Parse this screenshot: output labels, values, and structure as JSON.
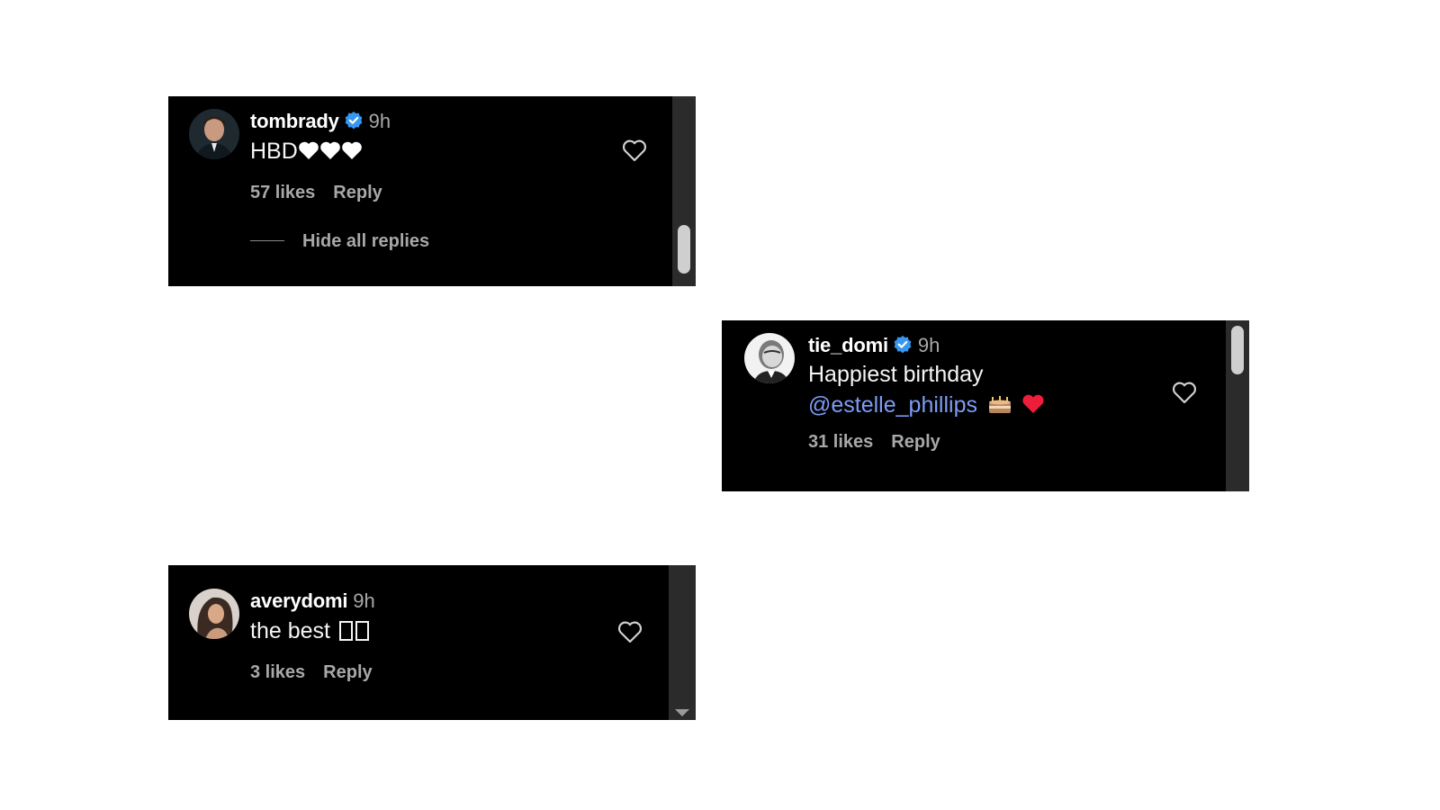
{
  "colors": {
    "background": "#ffffff",
    "card": "#000000",
    "scrollbar_track": "#2b2b2b",
    "verified_badge": "#3897f0",
    "mention": "#7d9cf7",
    "muted_text": "#a8a8a8"
  },
  "comments": [
    {
      "username": "tombrady",
      "verified": true,
      "time": "9h",
      "text": "HBD",
      "emoji": [
        "white-heart",
        "white-heart",
        "white-heart"
      ],
      "likes": "57 likes",
      "reply": "Reply",
      "hide_replies": "Hide all replies",
      "avatar_icon": "profile-photo-tombrady"
    },
    {
      "username": "tie_domi",
      "verified": true,
      "time": "9h",
      "text": "Happiest birthday",
      "mention": "@estelle_phillips",
      "emoji": [
        "birthday-cake",
        "red-heart"
      ],
      "likes": "31 likes",
      "reply": "Reply",
      "avatar_icon": "profile-photo-tie-domi"
    },
    {
      "username": "averydomi",
      "verified": false,
      "time": "9h",
      "text": "the best",
      "emoji": [
        "unrendered-glyph",
        "unrendered-glyph"
      ],
      "likes": "3 likes",
      "reply": "Reply",
      "avatar_icon": "profile-photo-averydomi"
    }
  ]
}
